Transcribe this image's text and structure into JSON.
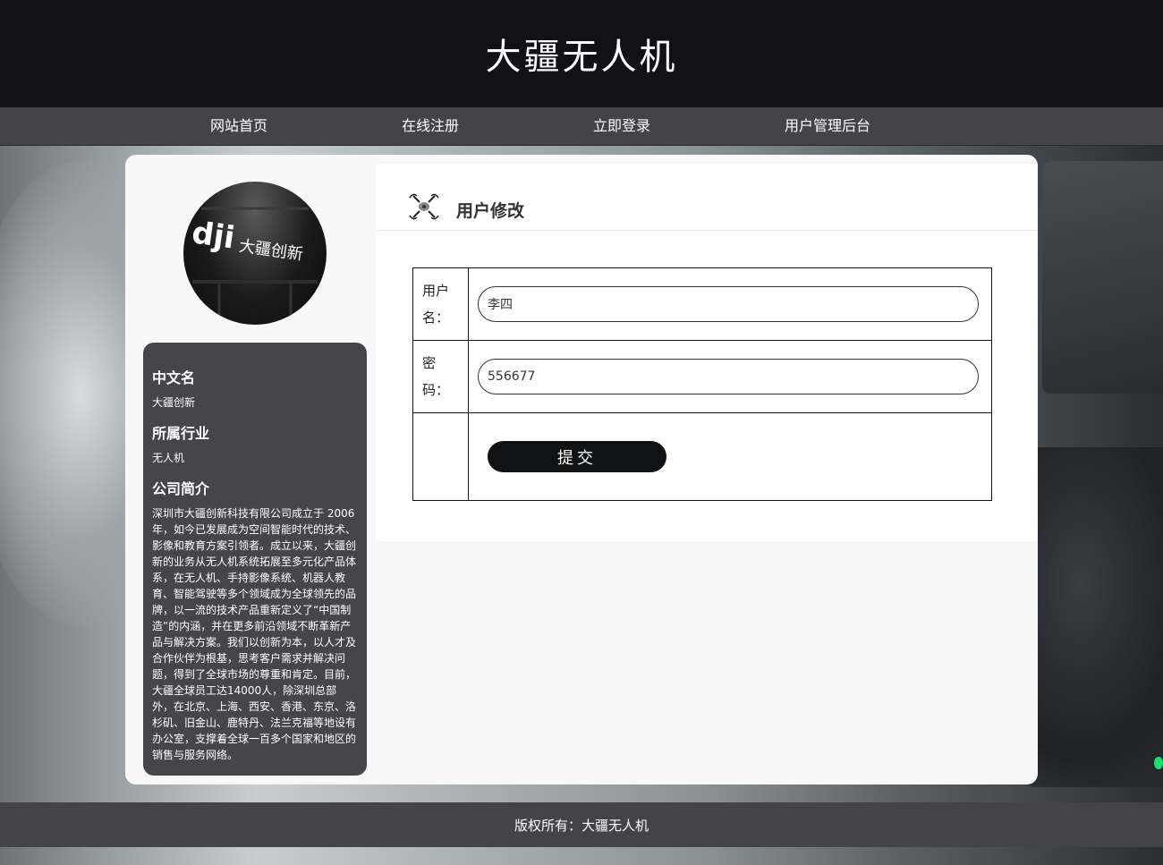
{
  "site": {
    "title": "大疆无人机"
  },
  "nav": {
    "items": [
      {
        "label": "网站首页"
      },
      {
        "label": "在线注册"
      },
      {
        "label": "立即登录"
      },
      {
        "label": "用户管理后台"
      }
    ]
  },
  "logo": {
    "alt_text": "dji 大疆创新"
  },
  "sidebar": {
    "sections": [
      {
        "heading": "中文名",
        "text": "大疆创新"
      },
      {
        "heading": "所属行业",
        "text": "无人机"
      },
      {
        "heading": "公司简介",
        "text": "深圳市大疆创新科技有限公司成立于 2006 年，如今已发展成为空间智能时代的技术、影像和教育方案引领者。成立以来，大疆创新的业务从无人机系统拓展至多元化产品体系，在无人机、手持影像系统、机器人教育、智能驾驶等多个领域成为全球领先的品牌，以一流的技术产品重新定义了“中国制造”的内涵，并在更多前沿领域不断革新产品与解决方案。我们以创新为本，以人才及合作伙伴为根基，思考客户需求并解决问题，得到了全球市场的尊重和肯定。目前，大疆全球员工达14000人，除深圳总部外，在北京、上海、西安、香港、东京、洛杉矶、旧金山、鹿特丹、法兰克福等地设有办公室，支撑着全球一百多个国家和地区的销售与服务网络。"
      }
    ]
  },
  "panel": {
    "title": "用户修改",
    "icon": "drone-icon"
  },
  "form": {
    "username_label": "用户名：",
    "username_value": "李四",
    "password_label": "密码：",
    "password_value": "556677",
    "submit_label": "提交"
  },
  "footer": {
    "text": "版权所有：大疆无人机"
  }
}
